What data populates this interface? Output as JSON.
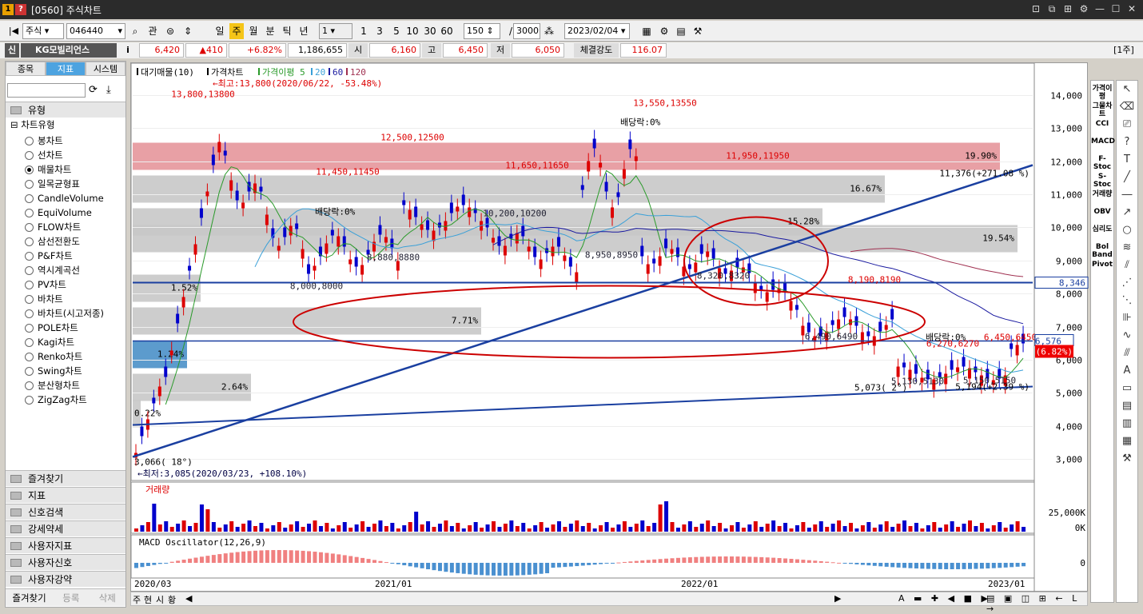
{
  "window": {
    "badge1": "1",
    "badge2": "?",
    "title": "[0560] 주식차트"
  },
  "toolbar": {
    "market": "주식",
    "code": "046440",
    "gwan": "관",
    "periods": [
      "일",
      "주",
      "월",
      "분",
      "틱",
      "년"
    ],
    "interval": "1",
    "quick": [
      "1",
      "3",
      "5",
      "10",
      "30",
      "60"
    ],
    "count": "150",
    "total": "3000",
    "date": "2023/02/04"
  },
  "infobar": {
    "tag": "신",
    "name": "KG모빌리언스",
    "i": "i",
    "price": "6,420",
    "change": "▲410",
    "pct": "+6.82%",
    "volume": "1,186,655",
    "open_label": "시",
    "open": "6,160",
    "high_label": "고",
    "high": "6,450",
    "low_label": "저",
    "low": "6,050",
    "strength_label": "체결강도",
    "strength": "116.07",
    "unit": "[1주]"
  },
  "left": {
    "tabs": [
      "종목",
      "지표",
      "시스템"
    ],
    "section_type": "유형",
    "tree_root": "차트유형",
    "items": [
      "봉차트",
      "선차트",
      "매물차트",
      "일목균형표",
      "CandleVolume",
      "EquiVolume",
      "FLOW차트",
      "삼선전환도",
      "P&F차트",
      "역시계곡선",
      "PV차트",
      "바차트",
      "바차트(시고저종)",
      "POLE차트",
      "Kagi차트",
      "Renko차트",
      "Swing차트",
      "분산형차트",
      "ZigZag차트"
    ],
    "selected": 2,
    "sections": [
      "즐겨찾기",
      "지표",
      "신호검색",
      "강세약세",
      "사용자지표",
      "사용자신호",
      "사용자강약"
    ],
    "bottom": [
      "즐겨찾기",
      "등록",
      "삭제"
    ]
  },
  "chart": {
    "legend": [
      "대기매물(10)",
      "가격차트",
      "가격이평 5",
      "20",
      "60",
      "120"
    ],
    "maxnote": "←최고:13,800(2020/06/22, -53.48%)",
    "minnote": "←최저:3,085(2020/03/23, +108.10%)",
    "yticks": [
      "14,000",
      "13,000",
      "12,000",
      "11,000",
      "10,000",
      "9,000",
      "8,000",
      "7,000",
      "6,000",
      "5,000",
      "4,000",
      "3,000"
    ],
    "xticks": [
      "2020/03",
      "2021/01",
      "2022/01",
      "2023/01"
    ],
    "bands": [
      [
        "19.90%",
        12100
      ],
      [
        "16.67%",
        11100
      ],
      [
        "15.28%",
        10100
      ],
      [
        "19.54%",
        9600
      ],
      [
        "7.71%",
        7100
      ],
      [
        "1.24%",
        6100
      ],
      [
        "2.64%",
        5100
      ],
      [
        "1.52%",
        8100
      ],
      [
        "0.22%",
        4300
      ]
    ],
    "labels": [
      [
        "13,800",
        13800
      ],
      [
        "13,550",
        13550
      ],
      [
        "12,500",
        12500
      ],
      [
        "11,950",
        11950
      ],
      [
        "11,650",
        11650
      ],
      [
        "11,450",
        11450
      ],
      [
        "10,200",
        10200
      ],
      [
        "8,880",
        8880
      ],
      [
        "8,950",
        8950
      ],
      [
        "8,000",
        8000
      ],
      [
        "8,190",
        8190
      ],
      [
        "6,490",
        6490
      ],
      [
        "6,450",
        6450
      ],
      [
        "5,130",
        5130
      ],
      [
        "5,150",
        5150
      ],
      [
        "8,320",
        8320
      ],
      [
        "6,270",
        6270
      ]
    ],
    "trend_labels": [
      "11,376(+271.08 %)",
      "5,073(  2°)",
      "5,194(+2.39 %)",
      "3,066( 18°)"
    ],
    "divlabels": [
      "배당락:0%",
      "배당락:0%",
      "배당락:0%"
    ],
    "pricebox_h": "8,346",
    "pricebox_cur": "6,576",
    "pricebox_pct": "(6.82%)",
    "vol_title": "거래량",
    "vol_ticks": [
      "25,000K",
      "0K"
    ],
    "macd_title": "MACD Oscillator(12,26,9)",
    "macd_tick": "0"
  },
  "bottom": {
    "tabs": [
      "주",
      "현",
      "시",
      "황"
    ]
  },
  "righttools": [
    "가격이평",
    "그물차트",
    "CCI",
    "MACD",
    "F-Stoc",
    "S-Stoc",
    "거래량",
    "OBV",
    "심리도",
    "Bol Band",
    "Pivot"
  ]
}
